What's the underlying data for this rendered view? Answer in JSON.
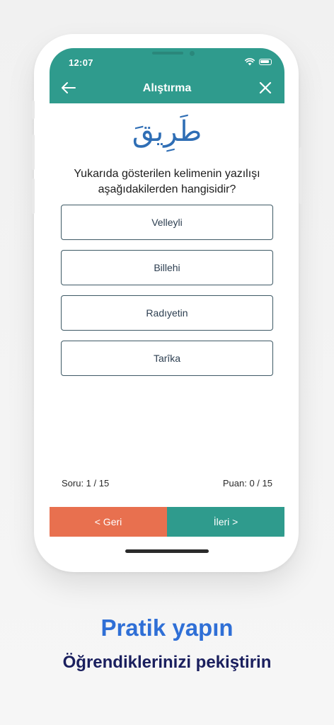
{
  "status_bar": {
    "time": "12:07"
  },
  "header": {
    "title": "Alıştırma"
  },
  "question": {
    "arabic_word": "طَرِيقَ",
    "text": "Yukarıda gösterilen kelimenin yazılışı aşağıdakilerden hangisidir?"
  },
  "options": [
    {
      "label": "Velleyli"
    },
    {
      "label": "Billehi"
    },
    {
      "label": "Radıyetin"
    },
    {
      "label": "Tarîka"
    }
  ],
  "progress": {
    "question_label": "Soru: 1 / 15",
    "score_label": "Puan: 0 / 15"
  },
  "navigation": {
    "back_label": "< Geri",
    "next_label": "İleri >"
  },
  "promo": {
    "title": "Pratik yapın",
    "subtitle": "Öğrendiklerinizi pekiştirin"
  },
  "colors": {
    "header": "#2f9b8d",
    "back_button": "#e8704f",
    "next_button": "#2f9b8d",
    "arabic_text": "#2f6eb5",
    "promo_title": "#2f6fd6",
    "promo_subtitle": "#1a1f5e"
  },
  "icons": {
    "back": "arrow-left-icon",
    "close": "close-icon",
    "wifi": "wifi-icon",
    "battery": "battery-icon"
  }
}
